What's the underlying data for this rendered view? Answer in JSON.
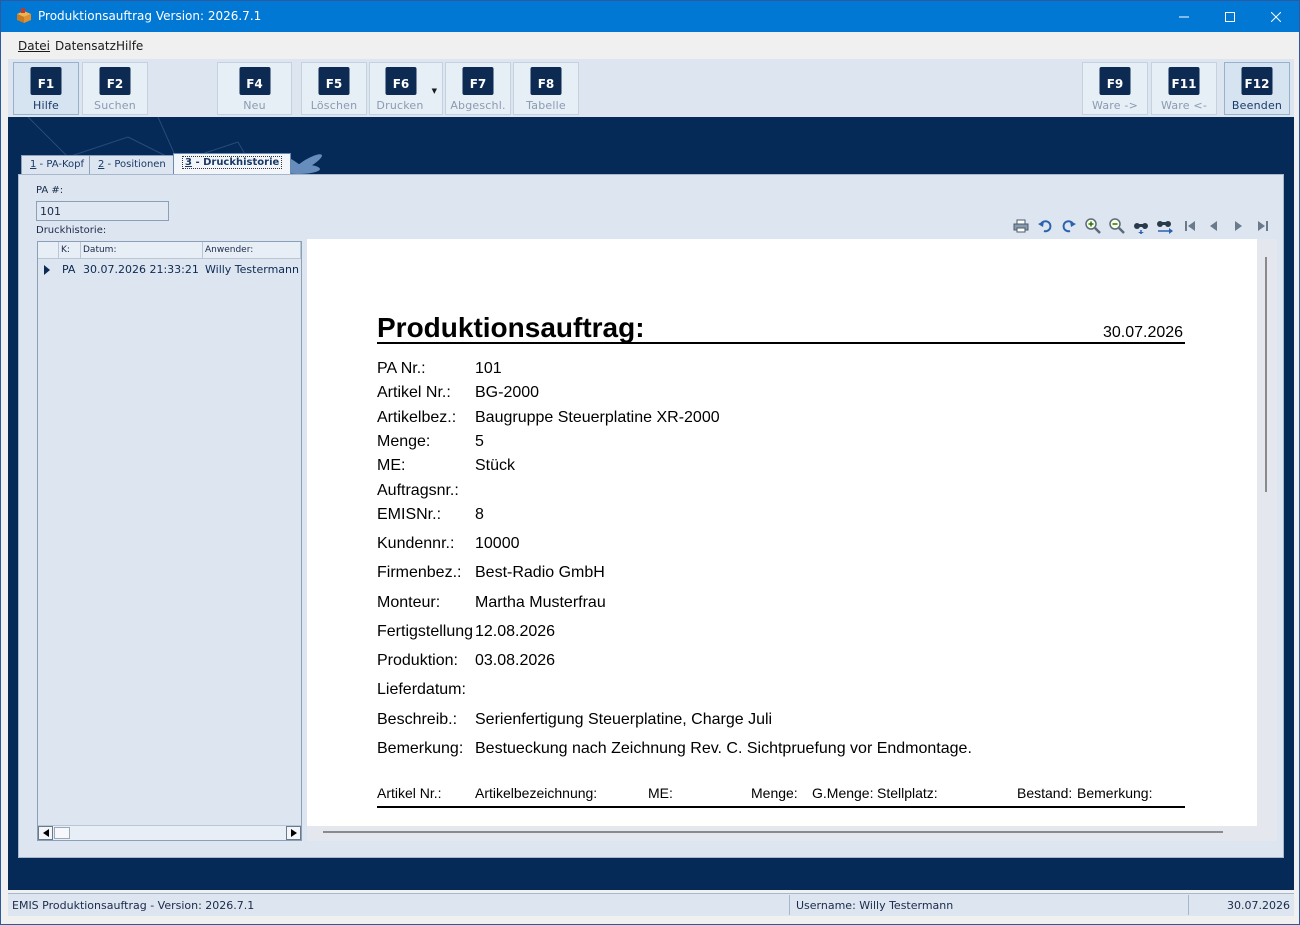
{
  "window": {
    "title": "Produktionsauftrag Version: 2026.7.1"
  },
  "menu": {
    "datei": "Datei",
    "datensatz": "Datensatz",
    "hilfe": "Hilfe"
  },
  "toolbar": {
    "buttons": [
      {
        "key": "F1",
        "label": "Hilfe"
      },
      {
        "key": "F2",
        "label": "Suchen"
      },
      {
        "key": "F4",
        "label": "Neu"
      },
      {
        "key": "F5",
        "label": "Löschen"
      },
      {
        "key": "F6",
        "label": "Drucken"
      },
      {
        "key": "F7",
        "label": "Abgeschl."
      },
      {
        "key": "F8",
        "label": "Tabelle"
      },
      {
        "key": "F9",
        "label": "Ware ->"
      },
      {
        "key": "F11",
        "label": "Ware <-"
      },
      {
        "key": "F12",
        "label": "Beenden"
      }
    ]
  },
  "tabs": [
    {
      "num": "1",
      "label": " - PA-Kopf"
    },
    {
      "num": "2",
      "label": " - Positionen"
    },
    {
      "num": "3",
      "label": " - Druckhistorie"
    }
  ],
  "form": {
    "pa_label": "PA #:",
    "pa_value": "101",
    "history_label": "Druckhistorie:"
  },
  "grid": {
    "headers": [
      "K:",
      "Datum:",
      "Anwender:"
    ],
    "rows": [
      {
        "k": "PA",
        "datum": "30.07.2026 21:33:21",
        "anwender": "Willy Testermann"
      }
    ]
  },
  "report": {
    "title": "Produktionsauftrag:",
    "date": "30.07.2026",
    "fields": [
      {
        "label": "PA Nr.:",
        "value": "101"
      },
      {
        "label": "Artikel Nr.:",
        "value": "BG-2000"
      },
      {
        "label": "Artikelbez.:",
        "value": "Baugruppe Steuerplatine XR-2000"
      },
      {
        "label": "Menge:",
        "value": "5"
      },
      {
        "label": "ME:",
        "value": "Stück"
      },
      {
        "label": "Auftragsnr.:",
        "value": ""
      },
      {
        "label": "EMISNr.:",
        "value": "8"
      },
      {
        "label": "Kundennr.:",
        "value": "10000"
      },
      {
        "label": "Firmenbez.:",
        "value": "Best-Radio GmbH"
      },
      {
        "label": "Monteur:",
        "value": "Martha Musterfrau"
      },
      {
        "label": "Fertigstellung",
        "value": "12.08.2026"
      },
      {
        "label": "Produktion:",
        "value": "03.08.2026"
      },
      {
        "label": "Lieferdatum:",
        "value": ""
      },
      {
        "label": "Beschreib.:",
        "value": "Serienfertigung Steuerplatine, Charge Juli"
      },
      {
        "label": "Bemerkung:",
        "value": "Bestueckung nach Zeichnung Rev. C. Sichtpruefung vor Endmontage."
      }
    ],
    "table_headers": [
      "Artikel Nr.:",
      "Artikelbezeichnung:",
      "ME:",
      "Menge:",
      "G.Menge:",
      "Stellplatz:",
      "Bestand:",
      "Bemerkung:"
    ]
  },
  "statusbar": {
    "app": "EMIS Produktionsauftrag - Version: 2026.7.1",
    "user": "Username: Willy Testermann",
    "date": "30.07.2026"
  }
}
